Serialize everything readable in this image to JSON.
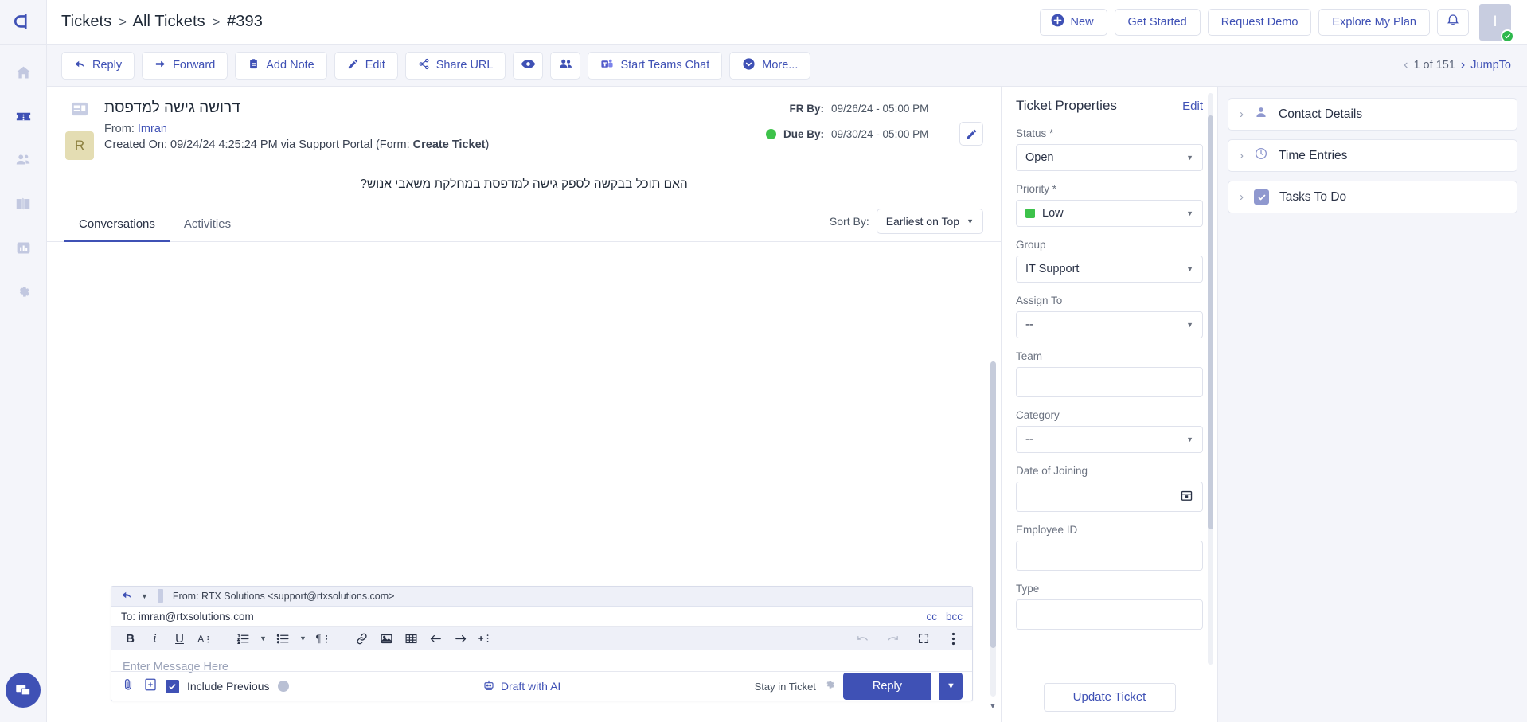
{
  "brand": {
    "accent": "#3f51b5",
    "green": "#3dc24a",
    "muted": "#6b7280"
  },
  "sidebar": {
    "items": [
      {
        "name": "home",
        "label": "Home"
      },
      {
        "name": "tickets",
        "label": "Tickets"
      },
      {
        "name": "contacts",
        "label": "Contacts"
      },
      {
        "name": "knowledge-base",
        "label": "Knowledge Base"
      },
      {
        "name": "reports",
        "label": "Reports"
      },
      {
        "name": "settings",
        "label": "Settings"
      }
    ],
    "chat_label": "Chat"
  },
  "topbar": {
    "breadcrumb": {
      "part1": "Tickets",
      "sep1": ">",
      "part2": "All Tickets",
      "sep2": ">",
      "part3": "#393"
    },
    "new_label": "New",
    "get_started_label": "Get Started",
    "request_demo_label": "Request Demo",
    "explore_plan_label": "Explore My Plan",
    "notifications_label": "Notifications",
    "avatar_initial": "I"
  },
  "actionbar": {
    "reply": "Reply",
    "forward": "Forward",
    "add_note": "Add Note",
    "edit": "Edit",
    "share_url": "Share URL",
    "watch": "Watch",
    "collaborators": "Collaborators",
    "teams_chat": "Start Teams Chat",
    "more": "More...",
    "pager_text": "1 of 151",
    "jump_to": "JumpTo"
  },
  "ticket": {
    "subject": "דרושה גישה למדפסת",
    "from_label": "From:",
    "from_name": "Imran",
    "created_line_pre": "Created On: 09/24/24 4:25:24 PM via Support Portal (Form: ",
    "created_form": "Create Ticket",
    "created_line_post": ")",
    "avatar_initial": "R",
    "fr_by_label": "FR By:",
    "fr_by_value": "09/26/24 - 05:00 PM",
    "due_by_label": "Due By:",
    "due_by_value": "09/30/24 - 05:00 PM",
    "message": "האם תוכל בבקשה לספק גישה למדפסת במחלקת משאבי אנוש?"
  },
  "tabs": {
    "conversations": "Conversations",
    "activities": "Activities",
    "sort_by_label": "Sort By:",
    "sort_by_value": "Earliest on Top"
  },
  "composer": {
    "from_line": "From: RTX Solutions <support@rtxsolutions.com>",
    "to_line": "To: imran@rtxsolutions.com",
    "cc": "cc",
    "bcc": "bcc",
    "editor_placeholder": "Enter Message Here",
    "toolbar": [
      {
        "name": "bold-icon",
        "glyph": "B"
      },
      {
        "name": "italic-icon",
        "glyph": "i"
      },
      {
        "name": "underline-icon",
        "glyph": "U"
      },
      {
        "name": "font-style-icon",
        "glyph": "A"
      },
      {
        "name": "ordered-list-icon",
        "glyph": "1."
      },
      {
        "name": "unordered-list-icon",
        "glyph": "•"
      },
      {
        "name": "paragraph-icon",
        "glyph": "¶"
      },
      {
        "name": "link-icon",
        "glyph": "link"
      },
      {
        "name": "image-icon",
        "glyph": "image"
      },
      {
        "name": "table-icon",
        "glyph": "table"
      },
      {
        "name": "outdent-icon",
        "glyph": "←"
      },
      {
        "name": "indent-icon",
        "glyph": "→"
      },
      {
        "name": "insert-icon",
        "glyph": "+"
      },
      {
        "name": "undo-icon",
        "glyph": "undo"
      },
      {
        "name": "redo-icon",
        "glyph": "redo"
      },
      {
        "name": "fullscreen-icon",
        "glyph": "fullscreen"
      },
      {
        "name": "more-options-icon",
        "glyph": "⋮"
      }
    ],
    "include_previous": "Include Previous",
    "draft_with_ai": "Draft with AI",
    "stay_in_ticket": "Stay in Ticket",
    "reply_button": "Reply"
  },
  "properties": {
    "title": "Ticket Properties",
    "edit": "Edit",
    "fields": [
      {
        "label": "Status",
        "required": true,
        "value": "Open",
        "type": "select",
        "swatch": null
      },
      {
        "label": "Priority",
        "required": true,
        "value": "Low",
        "type": "select",
        "swatch": "#3dc24a"
      },
      {
        "label": "Group",
        "required": false,
        "value": "IT Support",
        "type": "select",
        "swatch": null
      },
      {
        "label": "Assign To",
        "required": false,
        "value": "--",
        "type": "select",
        "swatch": null
      },
      {
        "label": "Team",
        "required": false,
        "value": "",
        "type": "text",
        "swatch": null
      },
      {
        "label": "Category",
        "required": false,
        "value": "--",
        "type": "select",
        "swatch": null
      },
      {
        "label": "Date of Joining",
        "required": false,
        "value": "",
        "type": "date",
        "swatch": null
      },
      {
        "label": "Employee ID",
        "required": false,
        "value": "",
        "type": "text",
        "swatch": null
      },
      {
        "label": "Type",
        "required": false,
        "value": "",
        "type": "text",
        "swatch": null
      }
    ],
    "update_button": "Update Ticket"
  },
  "right_panels": [
    {
      "label": "Contact Details",
      "icon": "person-icon"
    },
    {
      "label": "Time Entries",
      "icon": "clock-icon"
    },
    {
      "label": "Tasks To Do",
      "icon": "checkbox-icon"
    }
  ]
}
